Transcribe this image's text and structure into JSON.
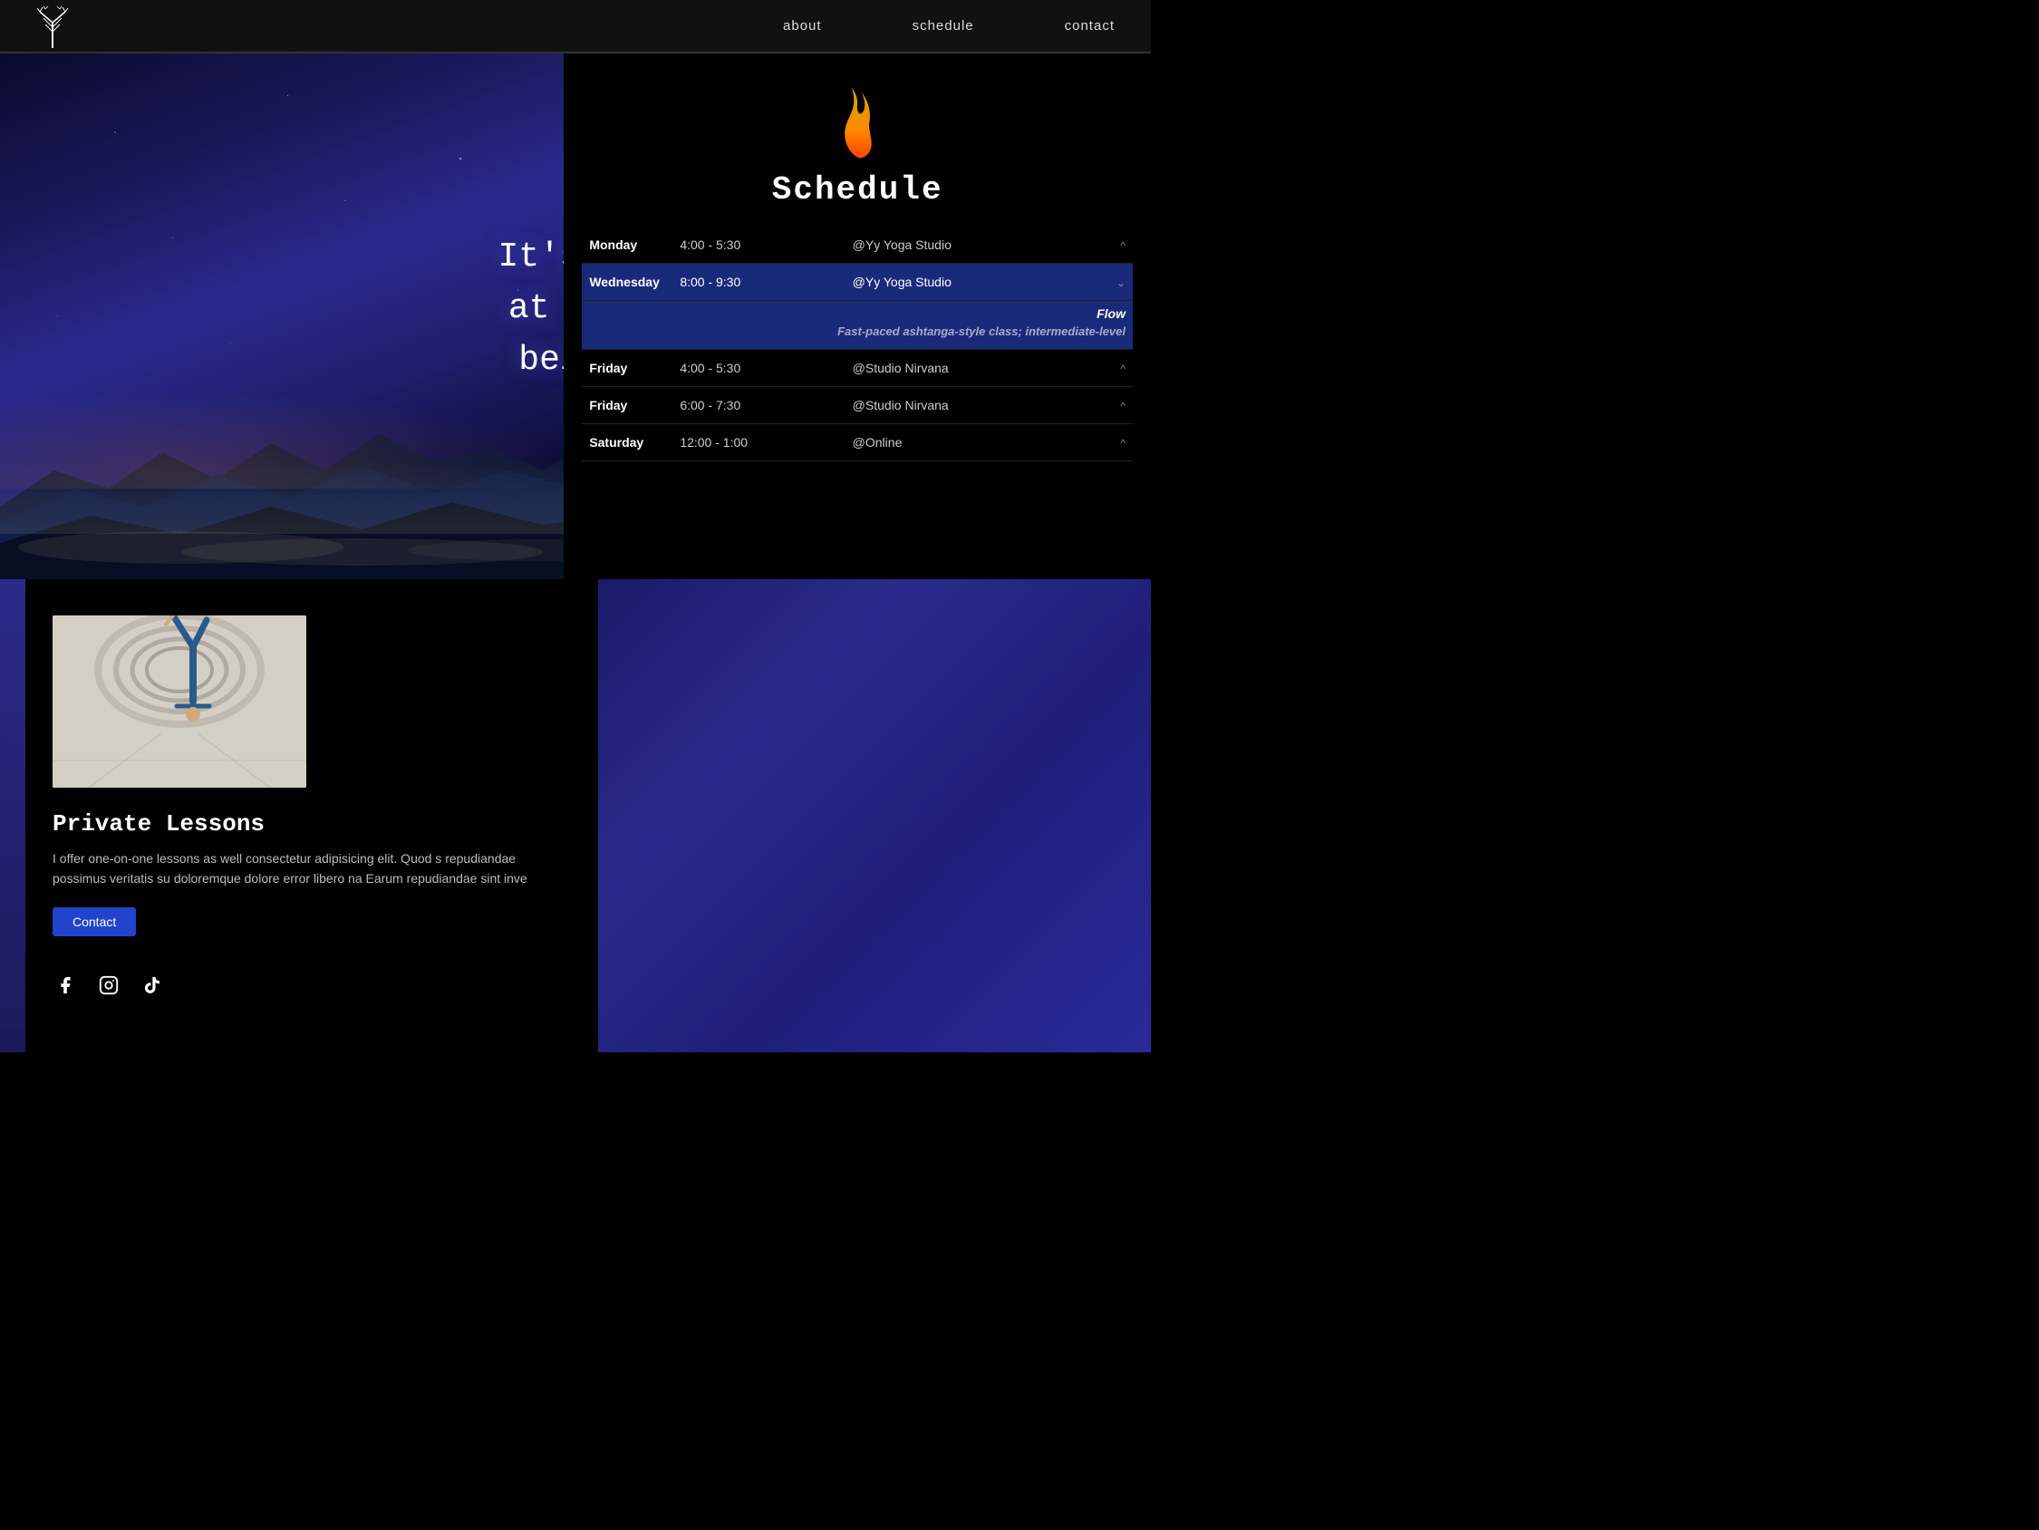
{
  "nav": {
    "about_label": "about",
    "schedule_label": "schedule",
    "contact_label": "contact"
  },
  "hero": {
    "quote": "It's not about being good\nat something. It's about\nbeing good to yourself."
  },
  "schedule": {
    "title": "Schedule",
    "rows": [
      {
        "day": "Monday",
        "time": "4:00 - 5:30",
        "location": "@Yy Yoga Studio",
        "chevron": "^",
        "expanded": false
      },
      {
        "day": "Wednesday",
        "time": "8:00 - 9:30",
        "location": "@Yy Yoga Studio",
        "chevron": "v",
        "expanded": true,
        "class_name": "Flow",
        "description": "Fast-paced ashtanga-style class; intermediate-level"
      },
      {
        "day": "Friday",
        "time": "4:00 - 5:30",
        "location": "@Studio Nirvana",
        "chevron": "^",
        "expanded": false
      },
      {
        "day": "Friday",
        "time": "6:00 - 7:30",
        "location": "@Studio Nirvana",
        "chevron": "^",
        "expanded": false
      },
      {
        "day": "Saturday",
        "time": "12:00 - 1:00",
        "location": "@Online",
        "chevron": "^",
        "expanded": false
      }
    ]
  },
  "private_lessons": {
    "title": "Private Lessons",
    "body": "I offer one-on-one lessons as well consectetur adipisicing elit. Quod s repudiandae possimus veritatis su doloremque dolore error libero na Earum repudiandae sint inve",
    "contact_button": "Contact"
  },
  "social": {
    "facebook": "f",
    "instagram": "ig",
    "tiktok": "tt"
  }
}
